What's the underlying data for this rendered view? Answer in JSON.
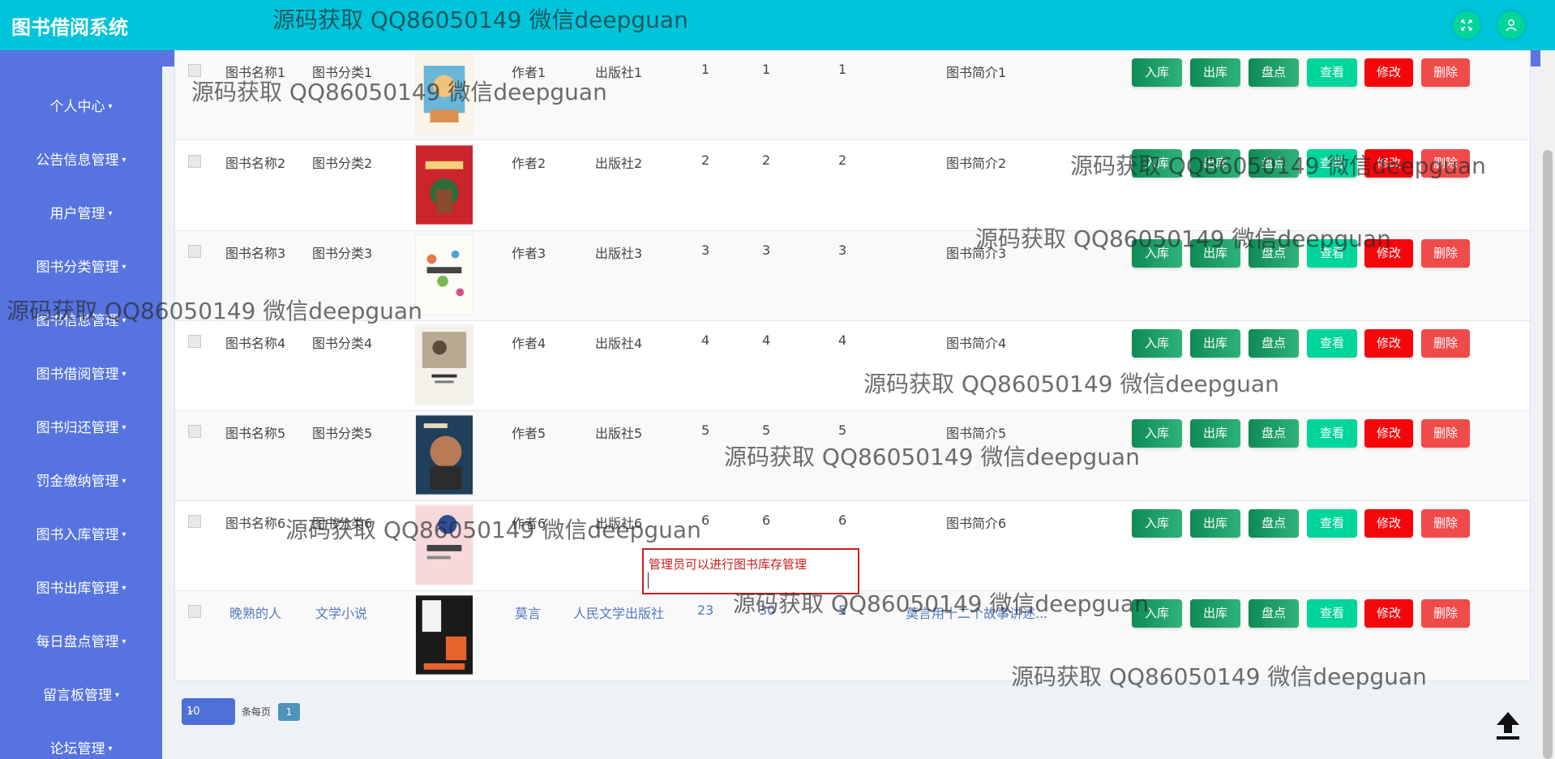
{
  "app": {
    "title": "图书借阅系统"
  },
  "header": {
    "fullscreen_icon": "fullscreen-icon",
    "user_icon": "user-icon"
  },
  "sidebar": {
    "items": [
      {
        "label": "个人中心"
      },
      {
        "label": "公告信息管理"
      },
      {
        "label": "用户管理"
      },
      {
        "label": "图书分类管理"
      },
      {
        "label": "图书信息管理"
      },
      {
        "label": "图书借阅管理"
      },
      {
        "label": "图书归还管理"
      },
      {
        "label": "罚金缴纳管理"
      },
      {
        "label": "图书入库管理"
      },
      {
        "label": "图书出库管理"
      },
      {
        "label": "每日盘点管理"
      },
      {
        "label": "留言板管理"
      },
      {
        "label": "论坛管理"
      }
    ]
  },
  "table": {
    "actions": {
      "in": "入库",
      "out": "出库",
      "inventory": "盘点",
      "view": "查看",
      "edit": "修改",
      "delete": "删除"
    },
    "rows": [
      {
        "name": "图书名称1",
        "category": "图书分类1",
        "author": "作者1",
        "publisher": "出版社1",
        "c1": "1",
        "c2": "1",
        "c3": "1",
        "intro": "图书简介1"
      },
      {
        "name": "图书名称2",
        "category": "图书分类2",
        "author": "作者2",
        "publisher": "出版社2",
        "c1": "2",
        "c2": "2",
        "c3": "2",
        "intro": "图书简介2"
      },
      {
        "name": "图书名称3",
        "category": "图书分类3",
        "author": "作者3",
        "publisher": "出版社3",
        "c1": "3",
        "c2": "3",
        "c3": "3",
        "intro": "图书简介3"
      },
      {
        "name": "图书名称4",
        "category": "图书分类4",
        "author": "作者4",
        "publisher": "出版社4",
        "c1": "4",
        "c2": "4",
        "c3": "4",
        "intro": "图书简介4"
      },
      {
        "name": "图书名称5",
        "category": "图书分类5",
        "author": "作者5",
        "publisher": "出版社5",
        "c1": "5",
        "c2": "5",
        "c3": "5",
        "intro": "图书简介5"
      },
      {
        "name": "图书名称6",
        "category": "图书分类6",
        "author": "作者6",
        "publisher": "出版社6",
        "c1": "6",
        "c2": "6",
        "c3": "6",
        "intro": "图书简介6"
      },
      {
        "name": "晚熟的人",
        "category": "文学小说",
        "author": "莫言",
        "publisher": "人民文学出版社",
        "c1": "23",
        "c2": "30",
        "c3": "5",
        "intro": "莫言用十二个故事讲述..."
      }
    ]
  },
  "pagination": {
    "page_size": "10",
    "per_page_label": "条每页",
    "current_page": "1"
  },
  "tooltip": {
    "text": "管理员可以进行图书库存管理"
  },
  "watermark": {
    "text": "源码获取 QQ86050149 微信deepguan"
  }
}
